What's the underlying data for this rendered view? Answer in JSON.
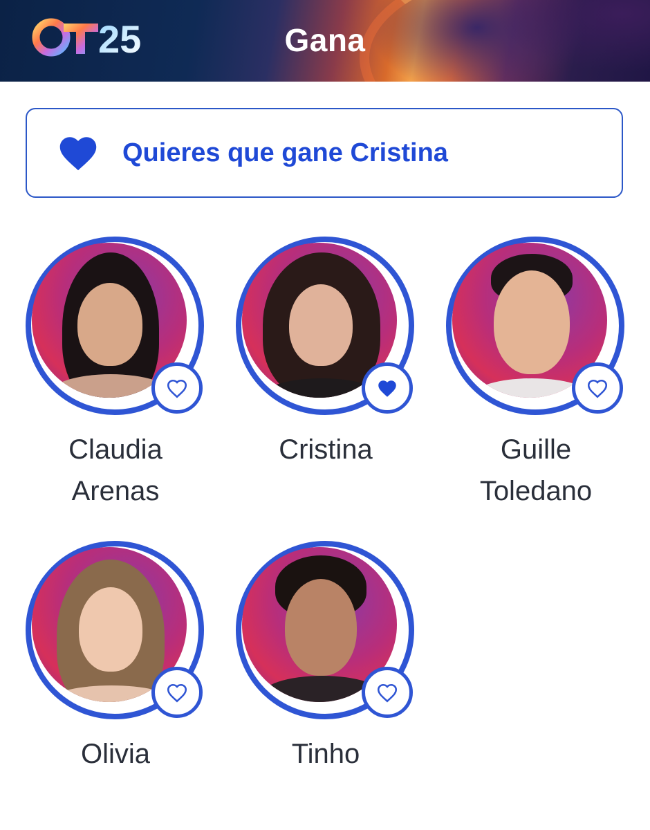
{
  "header": {
    "logo_text": "OT25",
    "title": "Gana"
  },
  "vote_banner": {
    "icon": "heart-filled-icon",
    "text": "Quieres que gane Cristina"
  },
  "colors": {
    "accent": "#2f55d4",
    "text_accent": "#1f49d6",
    "name_text": "#2a2f3a"
  },
  "contestants": [
    {
      "first": "Claudia",
      "last": "Arenas",
      "favorite": false,
      "icon": "heart-outline-icon"
    },
    {
      "first": "Cristina",
      "last": "",
      "favorite": true,
      "icon": "heart-filled-icon"
    },
    {
      "first": "Guille",
      "last": "Toledano",
      "favorite": false,
      "icon": "heart-outline-icon"
    },
    {
      "first": "Olivia",
      "last": "",
      "favorite": false,
      "icon": "heart-outline-icon"
    },
    {
      "first": "Tinho",
      "last": "",
      "favorite": false,
      "icon": "heart-outline-icon"
    }
  ]
}
